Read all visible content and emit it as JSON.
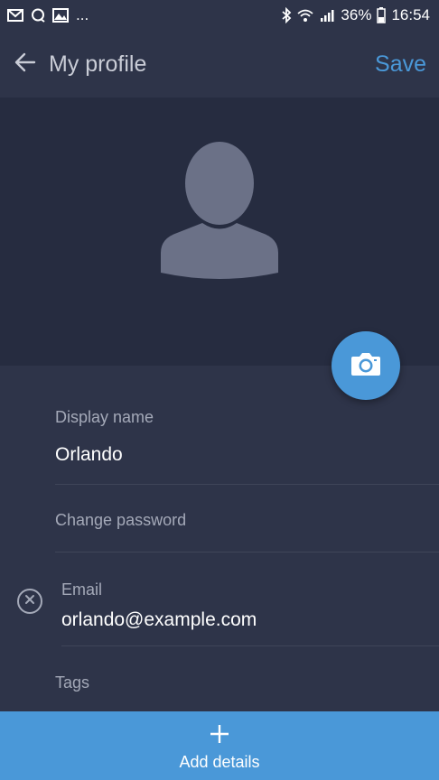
{
  "status_bar": {
    "notification_icons": [
      "mail-icon",
      "chat-icon",
      "gallery-icon"
    ],
    "more_indicator": "...",
    "battery_percent": "36%",
    "time": "16:54"
  },
  "toolbar": {
    "title": "My profile",
    "save_label": "Save"
  },
  "fields": {
    "display_name": {
      "label": "Display name",
      "value": "Orlando"
    },
    "change_password": {
      "label": "Change password"
    },
    "email": {
      "label": "Email",
      "value": "orlando@example.com"
    },
    "tags": {
      "label": "Tags"
    }
  },
  "bottom_action": {
    "label": "Add details"
  },
  "colors": {
    "background": "#2e3449",
    "photo_background": "#262c40",
    "accent": "#4a98d8",
    "label": "#a4a9b8",
    "avatar": "#6b7187"
  }
}
